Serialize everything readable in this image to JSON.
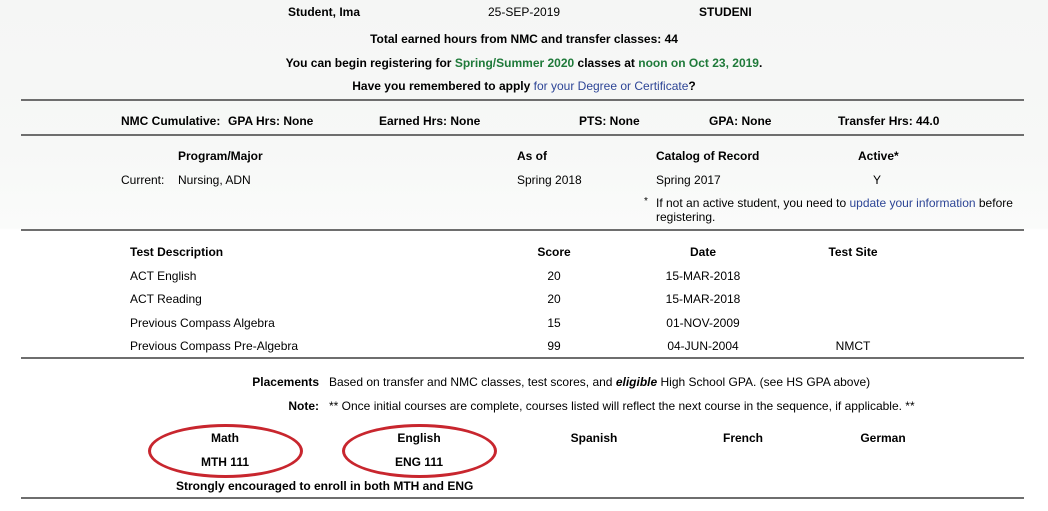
{
  "header": {
    "student_name": "Student, Ima",
    "date": "25-SEP-2019",
    "username": "STUDENI",
    "total_hours_text": "Total earned hours from NMC and transfer classes: 44",
    "register_prefix": "You can begin registering for ",
    "register_term": "Spring/Summer 2020",
    "register_middle": " classes at ",
    "register_time": "noon on Oct 23, 2019",
    "register_suffix": ".",
    "degree_prefix": "Have you remembered to apply ",
    "degree_link": "for your Degree or Certificate",
    "degree_suffix": "?"
  },
  "cumulative": {
    "label": "NMC Cumulative:",
    "gpa_hrs": "GPA Hrs: None",
    "earned_hrs": "Earned Hrs: None",
    "pts": "PTS: None",
    "gpa": "GPA: None",
    "transfer_hrs": "Transfer Hrs: 44.0"
  },
  "program": {
    "headers": {
      "program_major": "Program/Major",
      "as_of": "As of",
      "catalog": "Catalog of Record",
      "active": "Active*"
    },
    "current_label": "Current:",
    "current": {
      "program_major": "Nursing, ADN",
      "as_of": "Spring 2018",
      "catalog": "Spring 2017",
      "active": "Y"
    },
    "note_star": "*",
    "note_prefix": "If not an active student, you need to ",
    "note_link": "update your information",
    "note_suffix": " before",
    "note_line2": "registering."
  },
  "tests": {
    "headers": {
      "description": "Test Description",
      "score": "Score",
      "date": "Date",
      "site": "Test Site"
    },
    "rows": [
      {
        "description": "ACT English",
        "score": "20",
        "date": "15-MAR-2018",
        "site": ""
      },
      {
        "description": "ACT Reading",
        "score": "20",
        "date": "15-MAR-2018",
        "site": ""
      },
      {
        "description": "Previous Compass Algebra",
        "score": "15",
        "date": "01-NOV-2009",
        "site": ""
      },
      {
        "description": "Previous Compass Pre-Algebra",
        "score": "99",
        "date": "04-JUN-2004",
        "site": "NMCT"
      }
    ]
  },
  "placements": {
    "label": "Placements",
    "text_prefix": "Based on transfer and NMC classes, test scores, and ",
    "text_emphasis": "eligible",
    "text_suffix": " High School GPA. (see HS GPA above)",
    "note_label": "Note:",
    "note_text": "** Once initial courses are complete, courses listed will reflect the next course in the sequence, if applicable. **",
    "subjects": [
      {
        "name": "Math",
        "course": "MTH 111",
        "highlighted": true
      },
      {
        "name": "English",
        "course": "ENG 111",
        "highlighted": true
      },
      {
        "name": "Spanish",
        "course": "",
        "highlighted": false
      },
      {
        "name": "French",
        "course": "",
        "highlighted": false
      },
      {
        "name": "German",
        "course": "",
        "highlighted": false
      }
    ],
    "encouragement": "Strongly encouraged to enroll in both MTH and ENG",
    "highlight_color": "#c8262e"
  },
  "colors": {
    "green_text": "#1f7a3a",
    "link_blue": "#2d4596",
    "rule_gray": "#6e6e6e"
  }
}
